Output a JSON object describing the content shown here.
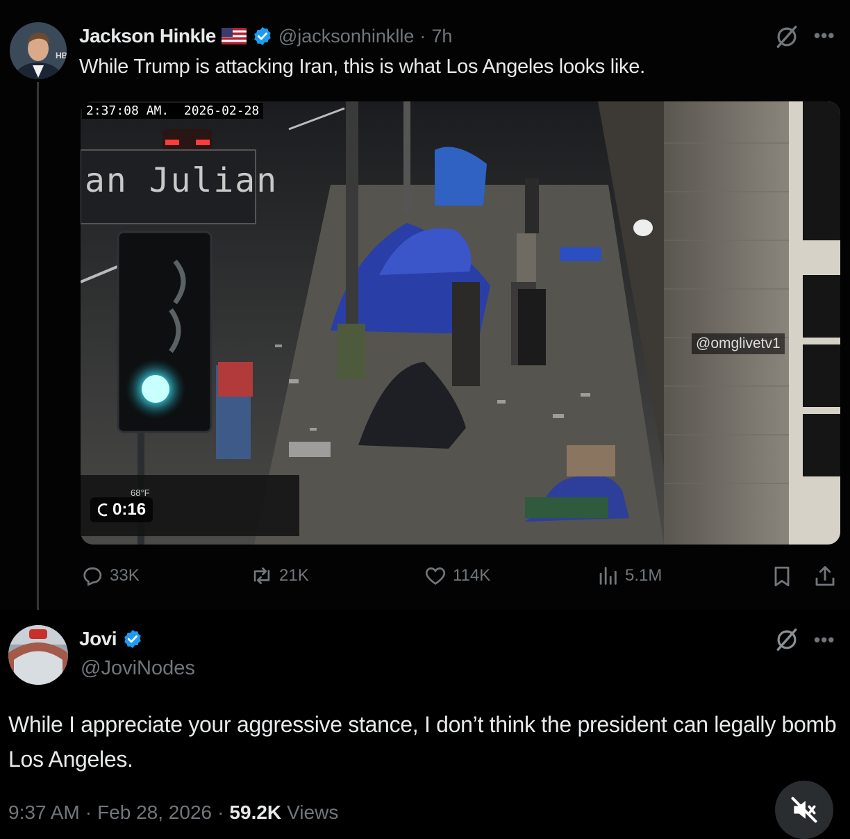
{
  "colors": {
    "accent": "#1d9bf0",
    "background": "#000000",
    "text": "#e7e9ea",
    "muted": "#71767b"
  },
  "original_post": {
    "author_name": "Jackson Hinkle",
    "author_flag": "US flag",
    "handle": "@jacksonhinklle",
    "separator": "·",
    "time": "7h",
    "text": "While Trump is attacking Iran, this is what Los Angeles looks like.",
    "media": {
      "overlay_timestamp": "2:37:08 AM.  2026-02-28",
      "street_sign": "an Julian",
      "watermark": "@omglivetv1",
      "video_time": "0:16",
      "weather_temp": "68°F"
    },
    "actions": {
      "replies": "33K",
      "reposts": "21K",
      "likes": "114K",
      "views": "5.1M"
    },
    "icons": [
      "grok-icon",
      "more-icon",
      "reply-icon",
      "repost-icon",
      "like-icon",
      "views-icon",
      "bookmark-icon",
      "share-icon",
      "verified-icon"
    ]
  },
  "reply_post": {
    "author_name": "Jovi",
    "handle": "@JoviNodes",
    "text": "While I appreciate your aggressive stance, I don’t think the president can legally bomb Los Angeles.",
    "time": "9:37 AM",
    "dot1": "·",
    "date": "Feb 28, 2026",
    "dot2": "·",
    "views_count": "59.2K",
    "views_label": "Views",
    "icons": [
      "grok-icon",
      "more-icon",
      "verified-icon",
      "mute-icon"
    ]
  }
}
